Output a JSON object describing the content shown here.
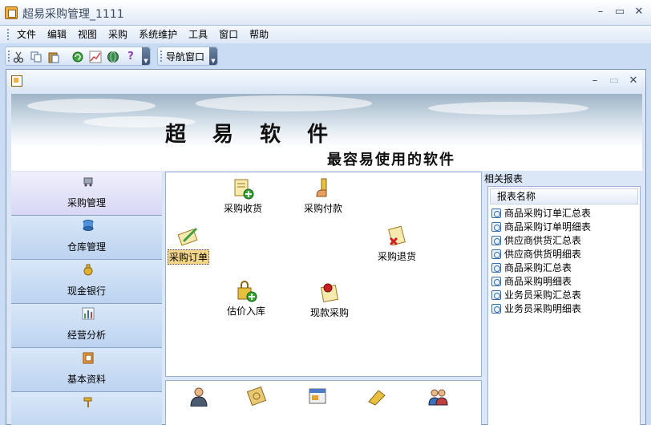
{
  "window": {
    "title": "超易采购管理_1111",
    "min": "–",
    "max": "▭",
    "close": "✕"
  },
  "menu": [
    "文件",
    "编辑",
    "视图",
    "采购",
    "系统维护",
    "工具",
    "窗口",
    "帮助"
  ],
  "toolbar": {
    "nav_label": "导航窗口",
    "drop": "▼"
  },
  "banner": {
    "title": "超 易 软 件",
    "subtitle": "最容易使用的软件"
  },
  "nav": [
    "采购管理",
    "仓库管理",
    "现金银行",
    "经营分析",
    "基本资料"
  ],
  "workspace": {
    "receive": "采购收货",
    "pay": "采购付款",
    "order": "采购订单",
    "return": "采购退货",
    "estimate": "估价入库",
    "cash_purchase": "现款采购"
  },
  "reports": {
    "section_title": "相关报表",
    "header": "报表名称",
    "items": [
      "商品采购订单汇总表",
      "商品采购订单明细表",
      "供应商供货汇总表",
      "供应商供货明细表",
      "商品采购汇总表",
      "商品采购明细表",
      "业务员采购汇总表",
      "业务员采购明细表"
    ]
  },
  "colors": {
    "accent": "#c9dcf3",
    "selected_label": "#f4d68a",
    "active_nav": "#e6e6fa"
  }
}
